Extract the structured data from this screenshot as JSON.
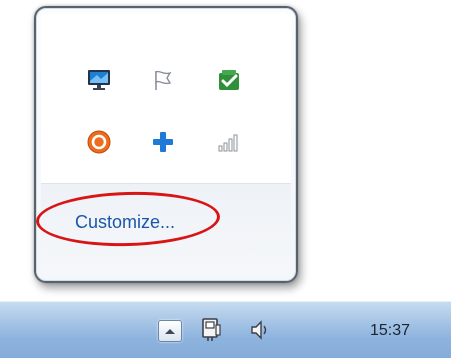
{
  "flyout": {
    "icons": [
      {
        "name": "display-monitor-icon",
        "row": 1,
        "col": 1
      },
      {
        "name": "action-center-flag-icon",
        "row": 1,
        "col": 2
      },
      {
        "name": "green-checkmark-icon",
        "row": 1,
        "col": 3
      },
      {
        "name": "orange-power-icon",
        "row": 2,
        "col": 1
      },
      {
        "name": "blue-plus-icon",
        "row": 2,
        "col": 2
      },
      {
        "name": "signal-strength-icon",
        "row": 2,
        "col": 3
      }
    ],
    "customize_label": "Customize..."
  },
  "annotation": {
    "highlight_color": "#d81515"
  },
  "taskbar": {
    "show_hidden_icon": "up-arrow-icon",
    "network_icon": "network-icon",
    "volume_icon": "speaker-icon",
    "clock": "15:37"
  },
  "colors": {
    "link": "#1a56a8",
    "taskbar_top": "#c6dcf0",
    "taskbar_bottom": "#86add9"
  }
}
